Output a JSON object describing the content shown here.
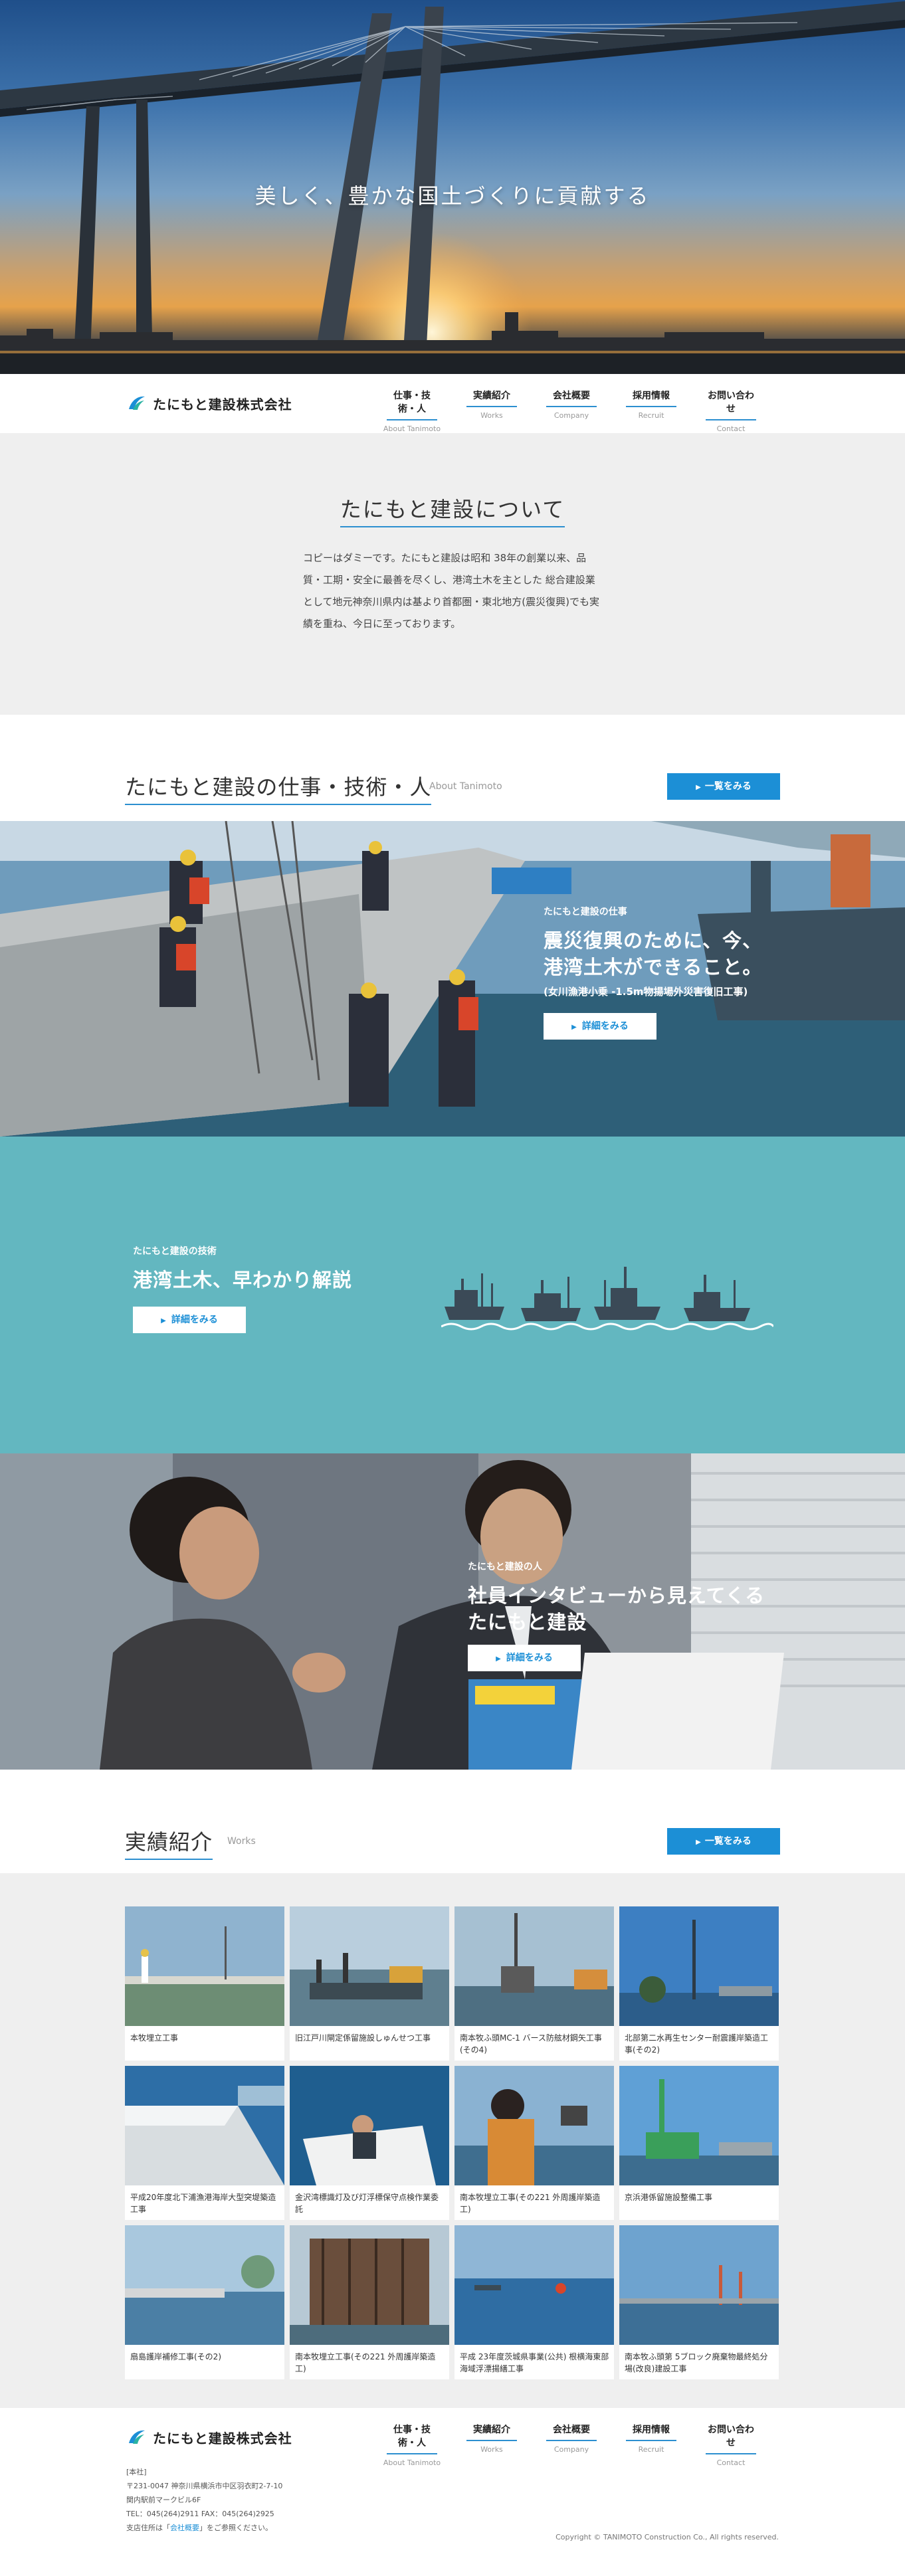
{
  "hero": {
    "catchcopy": "美しく、豊かな国土づくりに貢献する"
  },
  "header": {
    "logo_text": "たにもと建設株式会社",
    "nav": [
      {
        "jp": "仕事・技術・人",
        "en": "About Tanimoto"
      },
      {
        "jp": "実績紹介",
        "en": "Works"
      },
      {
        "jp": "会社概要",
        "en": "Company"
      },
      {
        "jp": "採用情報",
        "en": "Recruit"
      },
      {
        "jp": "お問い合わせ",
        "en": "Contact"
      }
    ]
  },
  "about": {
    "title": "たにもと建設について",
    "body": "コピーはダミーです。たにもと建設は昭和 38年の創業以来、品質・工期・安全に最善を尽くし、港湾土木を主とした 総合建設業として地元神奈川県内は基より首都圏・東北地方(震災復興)でも実績を重ね、今日に至っております。"
  },
  "about_section": {
    "title": "たにもと建設の仕事・技術・人",
    "sub": "About Tanimoto",
    "more_label": "一覧をみる"
  },
  "panel_job": {
    "label": "たにもと建設の仕事",
    "title_line1": "震災復興のために、今、",
    "title_line2": "港湾土木ができること。",
    "note": "(女川漁港小乗 -1.5m物揚場外災害復旧工事)",
    "button": "詳細をみる"
  },
  "panel_tech": {
    "label": "たにもと建設の技術",
    "title": "港湾土木、早わかり解説",
    "button": "詳細をみる",
    "colors": {
      "bg": "#63b7c0",
      "ship": "#3b4a57"
    }
  },
  "panel_people": {
    "label": "たにもと建設の人",
    "title_line1": "社員インタビューから見えてくる",
    "title_line2": "たにもと建設",
    "button": "詳細をみる"
  },
  "works_section": {
    "title": "実績紹介",
    "sub": "Works",
    "more_label": "一覧をみる"
  },
  "works": [
    {
      "caption": "本牧埋立工事"
    },
    {
      "caption": "旧江戸川閘定係留施設しゅんせつ工事"
    },
    {
      "caption": "南本牧ふ頭MC-1 バース防舷材鋼矢工事(その4)"
    },
    {
      "caption": "北部第二水再生センター耐震護岸築造工事(その2)"
    },
    {
      "caption": "平成20年度北下浦漁港海岸大型突堤築造工事"
    },
    {
      "caption": "金沢湾標識灯及び灯浮標保守点検作業委託"
    },
    {
      "caption": "南本牧埋立工事(その221 外周護岸築造工)"
    },
    {
      "caption": "京浜港係留施設整備工事"
    },
    {
      "caption": "扇島護岸補修工事(その2)"
    },
    {
      "caption": "南本牧埋立工事(その221 外周護岸築造工)"
    },
    {
      "caption": "平成 23年度茨城県事業(公共) 根横海東部海域浮漂揚繕工事"
    },
    {
      "caption": "南本牧ふ頭第 5ブロック廃棄物最終処分場(改良)建設工事"
    }
  ],
  "footer": {
    "logo_text": "たにもと建設株式会社",
    "nav": [
      {
        "jp": "仕事・技術・人",
        "en": "About Tanimoto"
      },
      {
        "jp": "実績紹介",
        "en": "Works"
      },
      {
        "jp": "会社概要",
        "en": "Company"
      },
      {
        "jp": "採用情報",
        "en": "Recruit"
      },
      {
        "jp": "お問い合わせ",
        "en": "Contact"
      }
    ],
    "head_office": "[本社]",
    "address": "〒231-0047 神奈川県横浜市中区羽衣町2-7-10",
    "building": "関内駅前マークビル6F",
    "tel": "TEL：045(264)2911  FAX：045(264)2925",
    "branch_prefix": "支店住所は「",
    "branch_link": "会社概要",
    "branch_suffix": "」をご参照ください。",
    "copyright": "Copyright © TANIMOTO Construction Co., All rights reserved."
  }
}
